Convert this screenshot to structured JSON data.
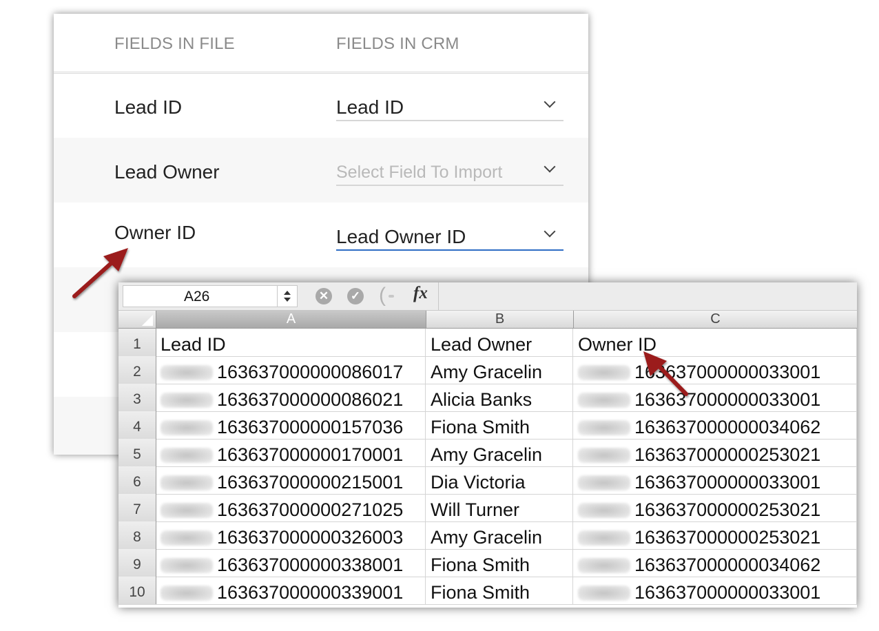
{
  "crm": {
    "header": {
      "fields_in_file": "FIELDS IN FILE",
      "fields_in_crm": "FIELDS IN CRM"
    },
    "rows": [
      {
        "file_field": "Lead ID",
        "crm_field": "Lead ID",
        "placeholder": false,
        "active": false
      },
      {
        "file_field": "Lead Owner",
        "crm_field": "Select Field To Import",
        "placeholder": true,
        "active": false
      },
      {
        "file_field": "Owner ID",
        "crm_field": "Lead Owner ID",
        "placeholder": false,
        "active": true
      }
    ]
  },
  "sheet": {
    "name_box": "A26",
    "formula_icons": [
      "cancel-icon",
      "confirm-icon",
      "fx-icon"
    ],
    "fx_label": "fx",
    "columns": [
      "A",
      "B",
      "C"
    ],
    "rows": [
      {
        "num": "1",
        "a": "Lead ID",
        "b": "Lead Owner",
        "c": "Owner ID"
      },
      {
        "num": "2",
        "a": "163637000000086017",
        "b": "Amy Gracelin",
        "c": "163637000000033001"
      },
      {
        "num": "3",
        "a": "163637000000086021",
        "b": "Alicia Banks",
        "c": "163637000000033001"
      },
      {
        "num": "4",
        "a": "163637000000157036",
        "b": "Fiona Smith",
        "c": "163637000000034062"
      },
      {
        "num": "5",
        "a": "163637000000170001",
        "b": "Amy Gracelin",
        "c": "163637000000253021"
      },
      {
        "num": "6",
        "a": "163637000000215001",
        "b": "Dia Victoria",
        "c": "163637000000033001"
      },
      {
        "num": "7",
        "a": "163637000000271025",
        "b": "Will Turner",
        "c": "163637000000253021"
      },
      {
        "num": "8",
        "a": "163637000000326003",
        "b": "Amy Gracelin",
        "c": "163637000000253021"
      },
      {
        "num": "9",
        "a": "163637000000338001",
        "b": "Fiona Smith",
        "c": "163637000000034062"
      },
      {
        "num": "10",
        "a": "163637000000339001",
        "b": "Fiona Smith",
        "c": "163637000000033001"
      }
    ]
  },
  "colors": {
    "arrow": "#9b1b1b",
    "active_underline": "#2d6cc4"
  }
}
